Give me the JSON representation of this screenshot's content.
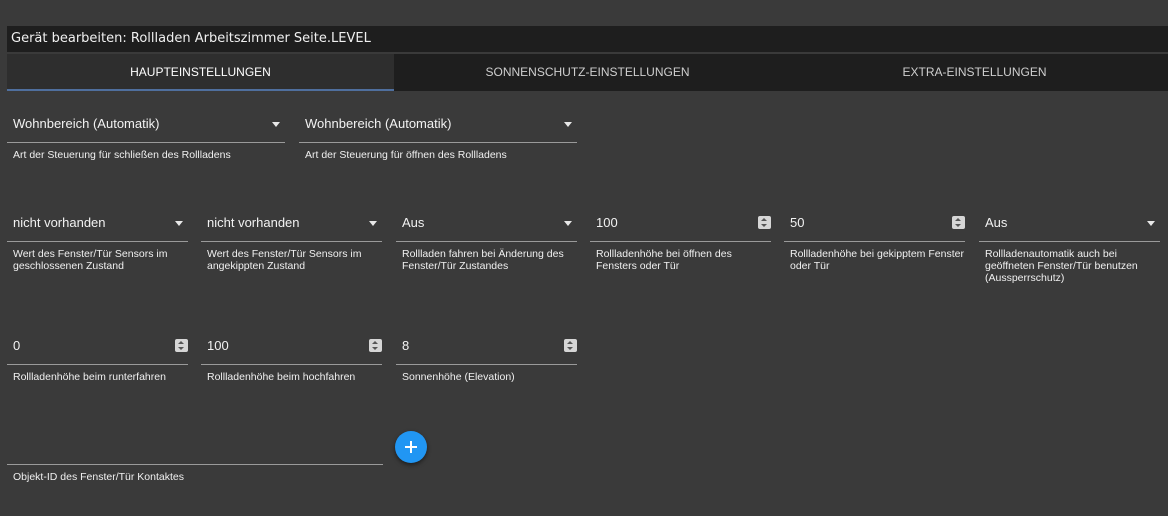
{
  "dialog": {
    "title": "Gerät bearbeiten: Rollladen Arbeitszimmer Seite.LEVEL"
  },
  "tabs": [
    {
      "label": "HAUPTEINSTELLUNGEN",
      "active": true
    },
    {
      "label": "SONNENSCHUTZ-EINSTELLUNGEN",
      "active": false
    },
    {
      "label": "EXTRA-EINSTELLUNGEN",
      "active": false
    }
  ],
  "fields": {
    "close_mode": {
      "value": "Wohnbereich (Automatik)",
      "label": "Art der Steuerung für schließen des Rollladens"
    },
    "open_mode": {
      "value": "Wohnbereich (Automatik)",
      "label": "Art der Steuerung für öffnen des Rollladens"
    },
    "sensor_closed": {
      "value": "nicht vorhanden",
      "label": "Wert des Fenster/Tür Sensors im geschlossenen Zustand"
    },
    "sensor_tilted": {
      "value": "nicht vorhanden",
      "label": "Wert des Fenster/Tür Sensors im angekippten Zustand"
    },
    "drive_on_change": {
      "value": "Aus",
      "label": "Rollladen fahren bei Änderung des Fenster/Tür Zustandes"
    },
    "height_open": {
      "value": "100",
      "label": "Rollladenhöhe bei öffnen des Fensters oder Tür"
    },
    "height_tilted": {
      "value": "50",
      "label": "Rollladenhöhe bei gekipptem Fenster oder Tür"
    },
    "lockout": {
      "value": "Aus",
      "label": "Rollladenautomatik auch bei geöffneten Fenster/Tür benutzen (Aussperrschutz)"
    },
    "height_down": {
      "value": "0",
      "label": "Rollladenhöhe beim runterfahren"
    },
    "height_up": {
      "value": "100",
      "label": "Rollladenhöhe beim hochfahren"
    },
    "elevation": {
      "value": "8",
      "label": "Sonnenhöhe (Elevation)"
    },
    "contact_id": {
      "value": "",
      "label": "Objekt-ID des Fenster/Tür Kontaktes"
    }
  },
  "icons": {
    "fab": "add-icon",
    "select": "caret-down-icon",
    "number": "spinner-icon"
  },
  "colors": {
    "fab": "#2196f3",
    "tab_indicator": "#4f6f9e"
  }
}
